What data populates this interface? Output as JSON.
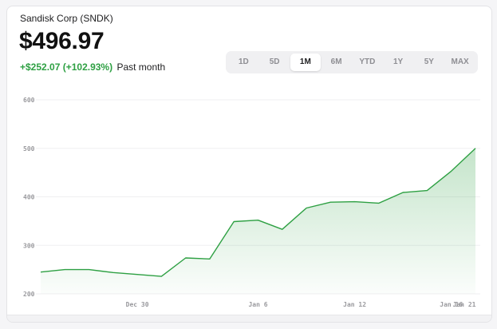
{
  "header": {
    "stock_name": "Sandisk Corp (SNDK)",
    "price": "$496.97",
    "change": "+$252.07 (+102.93%)",
    "period": "Past month"
  },
  "range_tabs": [
    {
      "label": "1D",
      "active": false
    },
    {
      "label": "5D",
      "active": false
    },
    {
      "label": "1M",
      "active": true
    },
    {
      "label": "6M",
      "active": false
    },
    {
      "label": "YTD",
      "active": false
    },
    {
      "label": "1Y",
      "active": false
    },
    {
      "label": "5Y",
      "active": false
    },
    {
      "label": "MAX",
      "active": false
    }
  ],
  "colors": {
    "line": "#2ea043",
    "positive": "#2ea043",
    "grid": "#efeff1"
  },
  "chart_data": {
    "type": "area",
    "title": "",
    "xlabel": "",
    "ylabel": "",
    "ylim": [
      200,
      600
    ],
    "yticks": [
      600,
      500,
      400,
      300,
      200
    ],
    "xticks": [
      {
        "label": "Dec 30",
        "index": 4
      },
      {
        "label": "Jan 6",
        "index": 9
      },
      {
        "label": "Jan 12",
        "index": 13
      },
      {
        "label": "Jan 16",
        "index": 17
      },
      {
        "label": "Jan 21",
        "index": 19
      }
    ],
    "grid": true,
    "series": [
      {
        "values": [
          245,
          250,
          250,
          244,
          240,
          236,
          274,
          272,
          349,
          352,
          333,
          377,
          389,
          390,
          387,
          409,
          413,
          453,
          500
        ]
      }
    ]
  }
}
